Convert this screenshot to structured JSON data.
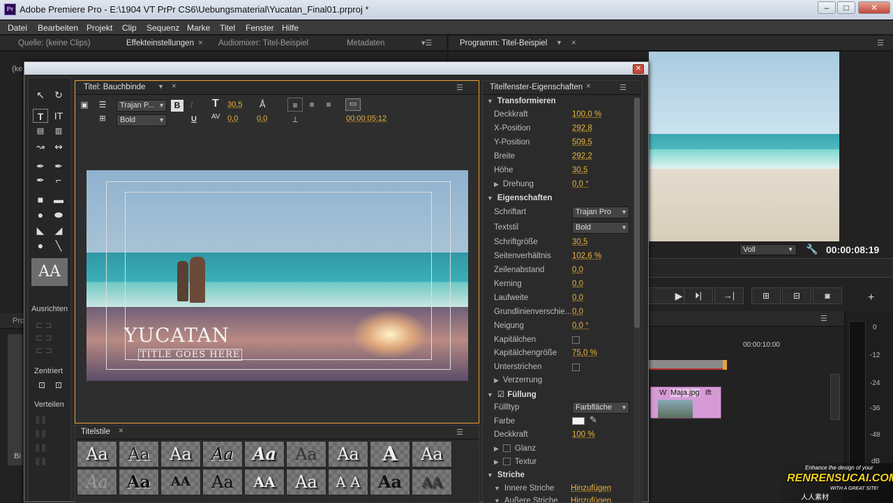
{
  "window": {
    "title": "Adobe Premiere Pro - E:\\1904 VT PrPr CS6\\Uebungsmaterial\\Yucatan_Final01.prproj *",
    "app_badge": "Pr"
  },
  "menu": [
    "Datei",
    "Bearbeiten",
    "Projekt",
    "Clip",
    "Sequenz",
    "Marke",
    "Titel",
    "Fenster",
    "Hilfe"
  ],
  "top_tabs": {
    "source": "Quelle: (keine Clips)",
    "effects": "Effekteinstellungen",
    "audiomixer": "Audiomixer: Titel-Beispiel",
    "metadata": "Metadaten"
  },
  "program": {
    "tab": "Programm: Titel-Beispiel",
    "zoom": "Voll",
    "timecode": "00:00:08:19"
  },
  "timeline": {
    "timecode_mark": "00:00:10:00",
    "clip1": "Maja.jpg",
    "clip1_prefix": "W",
    "clip2_suffix": "ift"
  },
  "meter": {
    "labels": [
      "0",
      "-12",
      "-24",
      "-36",
      "-48",
      "dB"
    ]
  },
  "left_fragments": {
    "ke": "(ke",
    "pro": "Pro",
    "bi": "Bi"
  },
  "dialog": {
    "title_tab": "Titel: Bauchbinde",
    "toolbar": {
      "font": "Trajan P...",
      "style": "Bold",
      "bold": "B",
      "italic": "I",
      "underline": "U",
      "size": "30,5",
      "kerning": "0,0",
      "leading": "0,0",
      "timecode": "00:00:05:12"
    },
    "tools": {
      "ausrichten": "Ausrichten",
      "zentriert": "Zentriert",
      "verteilen": "Verteilen",
      "aa": "AA"
    },
    "canvas": {
      "title": "YUCATAN",
      "subtitle": "TITLE GOES HERE"
    },
    "styles_tab": "Titelstile",
    "styles": [
      "Aa",
      "Aa",
      "Aa",
      "Aa",
      "Aa",
      "Aa",
      "Aa",
      "A",
      "Aa",
      "Aa",
      "Aa",
      "AA",
      "Aa",
      "AA",
      "Aa",
      "A A",
      "Aa",
      "AA"
    ],
    "props_tab": "Titelfenster-Eigenschaften",
    "props": {
      "transform": "Transformieren",
      "deckkraft_l": "Deckkraft",
      "deckkraft": "100,0 %",
      "xpos_l": "X-Position",
      "xpos": "292,8",
      "ypos_l": "Y-Position",
      "ypos": "509,5",
      "breite_l": "Breite",
      "breite": "292,2",
      "hoehe_l": "Höhe",
      "hoehe": "30,5",
      "drehung_l": "Drehung",
      "drehung": "0,0 °",
      "eigen": "Eigenschaften",
      "schriftart_l": "Schriftart",
      "schriftart": "Trajan Pro",
      "textstil_l": "Textstil",
      "textstil": "Bold",
      "groesse_l": "Schriftgröße",
      "groesse": "30,5",
      "seiten_l": "Seitenverhältnis",
      "seiten": "102,6 %",
      "zeilen_l": "Zeilenabstand",
      "zeilen": "0,0",
      "kerning_l": "Kerning",
      "kerning": "0,0",
      "laufweite_l": "Laufweite",
      "laufweite": "0,0",
      "grund_l": "Grundlinienverschie...",
      "grund": "0,0",
      "neigung_l": "Neigung",
      "neigung": "0,0 °",
      "kap_l": "Kapitälchen",
      "kapg_l": "Kapitälchengröße",
      "kapg": "75,0 %",
      "unter_l": "Unterstrichen",
      "verz_l": "Verzerrung",
      "fuellung": "Füllung",
      "fuelltyp_l": "Füllltyp",
      "fuelltyp": "Farbfläche",
      "farbe_l": "Farbe",
      "deck2_l": "Deckkraft",
      "deck2": "100 %",
      "glanz_l": "Glanz",
      "textur_l": "Textur",
      "striche": "Striche",
      "innere_l": "Innere Striche",
      "innere": "Hinzufügen",
      "aeussere_l": "Äußere Striche",
      "aeussere": "Hinzufügen"
    }
  },
  "watermark": {
    "line1": "Enhance the design of your",
    "brand": "RENRENSUCAI.COM",
    "line2": "WITH A GREAT SITE!",
    "cn": "人人素材"
  }
}
